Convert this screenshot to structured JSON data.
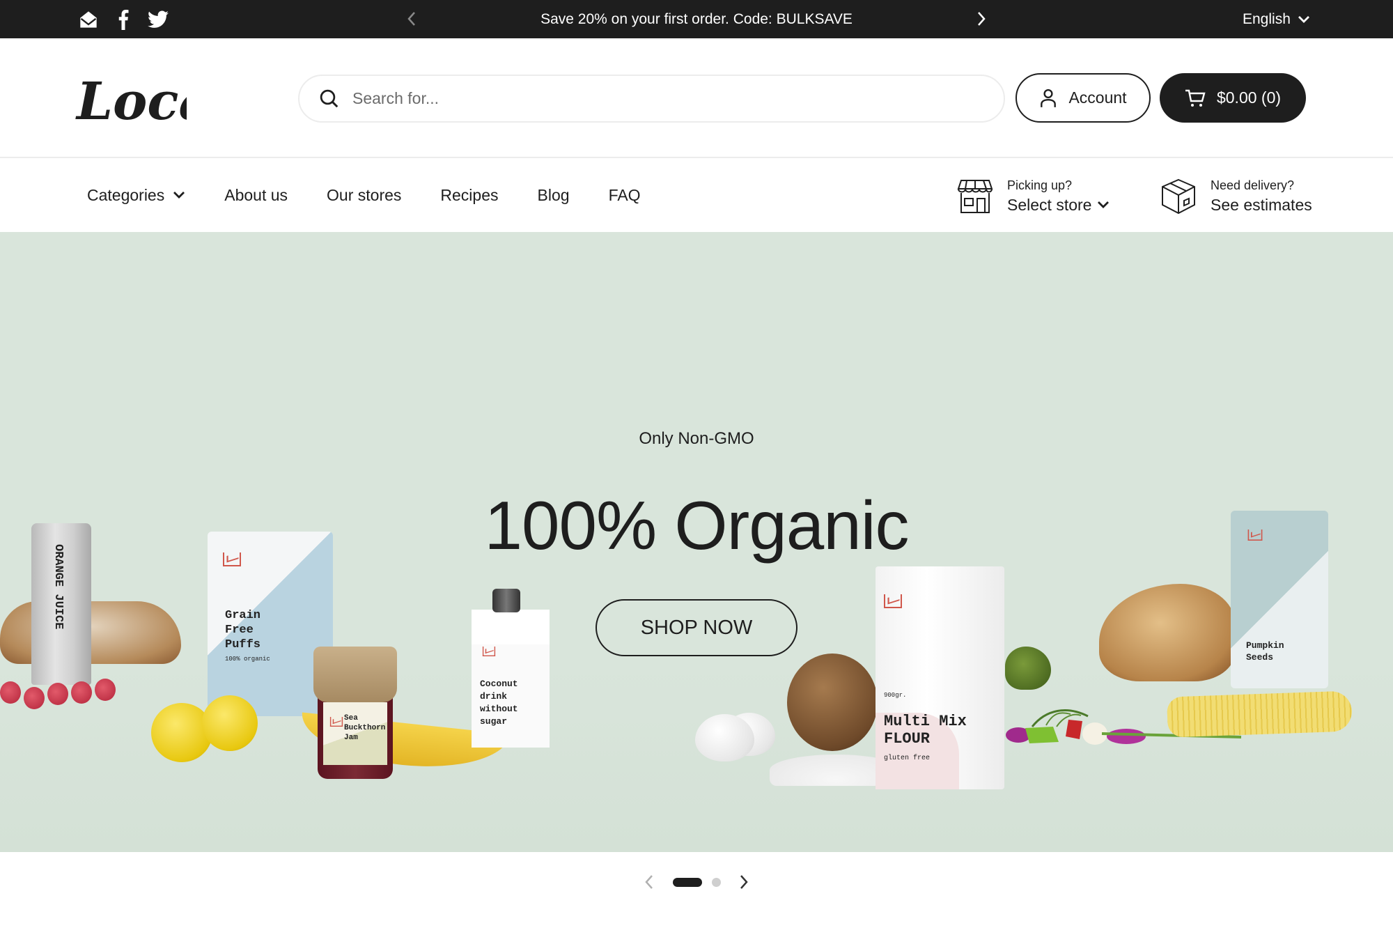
{
  "announcement": {
    "social": [
      {
        "name": "email-icon",
        "label": "Email"
      },
      {
        "name": "facebook-icon",
        "label": "Facebook"
      },
      {
        "name": "twitter-icon",
        "label": "Twitter"
      }
    ],
    "message": "Save 20% on your first order. Code: BULKSAVE",
    "language": "English"
  },
  "header": {
    "logo_text": "Local",
    "search_placeholder": "Search for...",
    "account_label": "Account",
    "cart_label": "$0.00 (0)"
  },
  "nav": {
    "items": [
      {
        "label": "Categories",
        "has_dropdown": true
      },
      {
        "label": "About us"
      },
      {
        "label": "Our stores"
      },
      {
        "label": "Recipes"
      },
      {
        "label": "Blog"
      },
      {
        "label": "FAQ"
      }
    ],
    "pickup": {
      "small": "Picking up?",
      "big": "Select store"
    },
    "delivery": {
      "small": "Need delivery?",
      "big": "See estimates"
    }
  },
  "hero": {
    "subtitle": "Only Non-GMO",
    "title": "100% Organic",
    "cta": "SHOP NOW",
    "background": "#d9e5db",
    "products": {
      "orange_juice": "ORANGE JUICE",
      "puffs": "Grain Free Puffs",
      "puffs_sub": "100% organic",
      "jam": "Sea Buckthorn Jam",
      "coconut": "Coconut drink without sugar",
      "flour_weight": "900gr.",
      "flour": "Multi Mix FLOUR",
      "flour_sub": "gluten free",
      "pumpkin": "Pumpkin Seeds"
    }
  },
  "slider": {
    "total_slides": 2,
    "active_slide": 1
  }
}
